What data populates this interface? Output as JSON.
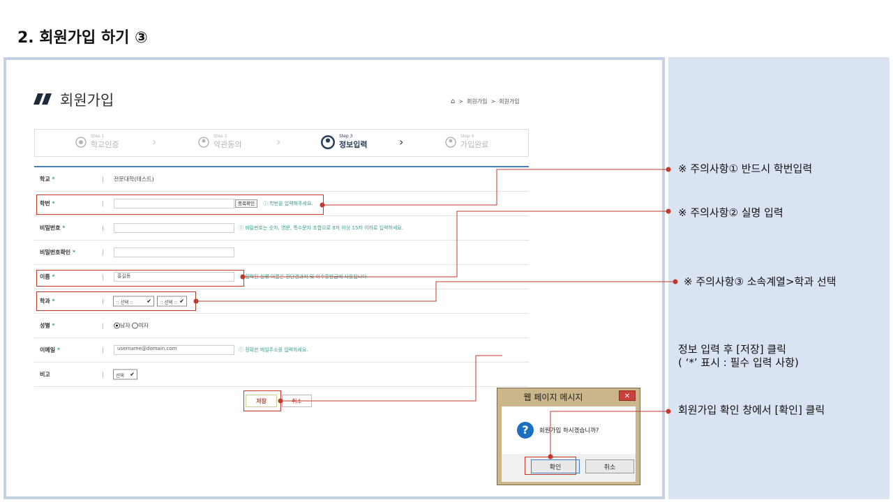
{
  "slide": {
    "title": "2. 회원가입 하기 ③"
  },
  "page": {
    "title": "회원가입",
    "breadcrumb": [
      "회원가입",
      "회원가입"
    ]
  },
  "steps": [
    {
      "num": "Step 1",
      "label": "학교인증",
      "active": false
    },
    {
      "num": "Step 2",
      "label": "약관동의",
      "active": false
    },
    {
      "num": "Step 3",
      "label": "정보입력",
      "active": true
    },
    {
      "num": "Step 4",
      "label": "가입완료",
      "active": false
    }
  ],
  "form": {
    "school": {
      "label": "학교",
      "value": "전문대학(테스트)"
    },
    "student_id": {
      "label": "학번",
      "value": "",
      "check_button": "중복확인",
      "hint": "학번을 입력해주세요."
    },
    "password": {
      "label": "비밀번호",
      "value": "",
      "hint": "비밀번호는 숫자, 영문, 특수문자 조합으로 8자 이상 15자 이하로 입력하세요."
    },
    "password_confirm": {
      "label": "비밀번호확인",
      "value": ""
    },
    "name": {
      "label": "이름",
      "value": "홍길동",
      "hint": "입력된 실명 이름은 진단결과지 및 이수증발급에 사용됩니다."
    },
    "department": {
      "label": "학과",
      "select1": ":: 선택 ::",
      "select2": ":: 선택 ::"
    },
    "gender": {
      "label": "성별",
      "option_male": "남자",
      "option_female": "여자",
      "selected": "남자"
    },
    "email": {
      "label": "이메일",
      "value": "username@domain.com",
      "hint": "정확한 메일주소를 입력하세요."
    },
    "note": {
      "label": "비고",
      "select": "선택"
    },
    "required_mark": "*",
    "save_label": "저장",
    "cancel_label": "취소"
  },
  "dialog": {
    "title": "웹 페이지 메시지",
    "close": "✕",
    "message": "회원가입 하시겠습니까?",
    "confirm_label": "확인",
    "cancel_label": "취소"
  },
  "annotations": {
    "note1": "※ 주의사항① 반드시 학번입력",
    "note2": "※ 주의사항② 실명 입력",
    "note3": "※ 주의사항③ 소속계열>학과 선택",
    "note4_line1": "정보 입력 후 [저장] 클릭",
    "note4_line2": "( ‘*’ 표시 : 필수 입력 사항)",
    "note5": "회원가입 확인 창에서 [확인] 클릭"
  },
  "colors": {
    "accent_red": "#c0392b",
    "side_panel": "#d9e3f2",
    "frame": "#c5d1e0",
    "form_line": "#4a7fb5"
  },
  "icons": {
    "home": "home-icon",
    "question": "question-icon"
  }
}
